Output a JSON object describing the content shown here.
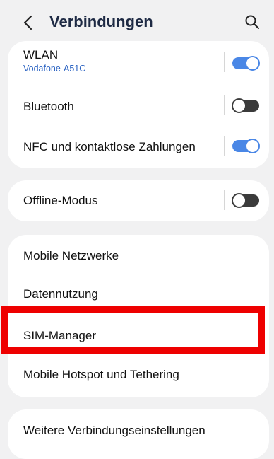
{
  "header": {
    "title": "Verbindungen",
    "back_icon": "chevron-left-icon",
    "search_icon": "search-icon"
  },
  "group1": {
    "wlan": {
      "label": "WLAN",
      "sub": "Vodafone-A51C",
      "toggle": "on"
    },
    "bluetooth": {
      "label": "Bluetooth",
      "toggle": "off"
    },
    "nfc": {
      "label": "NFC und kontaktlose Zahlungen",
      "toggle": "on"
    }
  },
  "group2": {
    "offline": {
      "label": "Offline-Modus",
      "toggle": "off"
    }
  },
  "group3": {
    "mobile_networks": {
      "label": "Mobile Netzwerke"
    },
    "data_usage": {
      "label": "Datennutzung"
    },
    "sim_manager": {
      "label": "SIM-Manager"
    },
    "hotspot": {
      "label": "Mobile Hotspot und Tethering"
    }
  },
  "group4": {
    "more": {
      "label": "Weitere Verbindungseinstellungen"
    }
  },
  "colors": {
    "accent": "#4a87e6",
    "highlight": "#ee0000",
    "background": "#f1f1f2",
    "sub_text": "#2b63c2"
  }
}
